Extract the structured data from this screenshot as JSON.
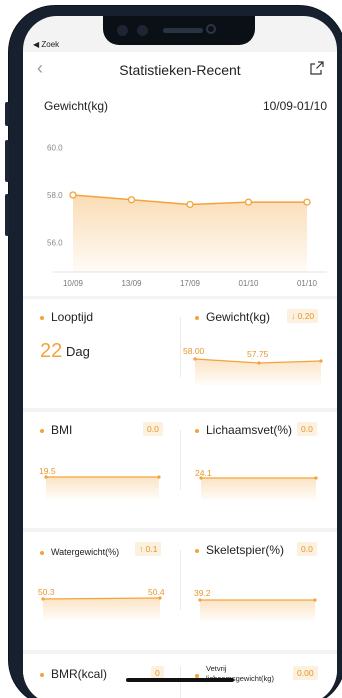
{
  "status": {
    "back_app": "◀ Zoek"
  },
  "nav": {
    "title": "Statistieken-Recent"
  },
  "chart": {
    "title": "Gewicht(kg)",
    "range": "10/09-01/10"
  },
  "chart_data": {
    "type": "area",
    "x": [
      "10/09",
      "13/09",
      "17/09",
      "01/10",
      "01/10"
    ],
    "yticks": [
      "60.0",
      "58.0",
      "56.0"
    ],
    "values": [
      58.0,
      57.8,
      57.6,
      57.7,
      57.7
    ],
    "ylim": [
      55.0,
      61.0
    ],
    "color": "#f3a33c"
  },
  "cards": {
    "looptijd": {
      "label": "Looptijd",
      "value": "22",
      "unit": "Dag"
    },
    "gewicht": {
      "label": "Gewicht(kg)",
      "badge": "↓ 0.20",
      "start": "58.00",
      "end": "57.75"
    },
    "bmi": {
      "label": "BMI",
      "badge": "0.0",
      "start": "19.5"
    },
    "vet": {
      "label": "Lichaamsvet(%)",
      "badge": "0.0",
      "start": "24.1"
    },
    "water": {
      "label": "Watergewicht(%)",
      "badge": "↑ 0.1",
      "start": "50.3",
      "end": "50.4"
    },
    "skelet": {
      "label": "Skeletspier(%)",
      "badge": "0.0",
      "start": "39.2"
    },
    "bmr": {
      "label": "BMR(kcal)",
      "badge": "0"
    },
    "vetvrij": {
      "label_line1": "Vetvrij",
      "label_line2": "lichaamsgewicht(kg)",
      "badge": "0.00"
    }
  },
  "colors": {
    "accent": "#f3a33c",
    "accent_light": "#fcf0de",
    "bezel": "#17202e"
  }
}
